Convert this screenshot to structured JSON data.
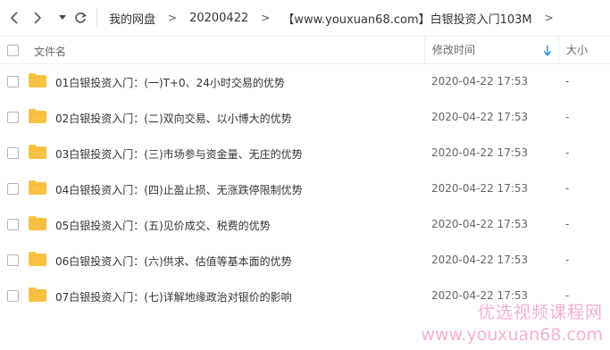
{
  "toolbar": {
    "back_icon": "chevron-left-icon",
    "forward_icon": "chevron-right-icon",
    "dropdown_icon": "caret-down-icon",
    "refresh_icon": "refresh-icon"
  },
  "breadcrumb": {
    "items": [
      "我的网盘",
      "20200422",
      "【www.youxuan68.com】白银投资入门103M"
    ],
    "separator": ">"
  },
  "table": {
    "headers": {
      "name": "文件名",
      "modified": "修改时间",
      "size": "大小"
    },
    "sort_icon": "arrow-down-icon",
    "rows": [
      {
        "name": "01白银投资入门：(一)T+0、24小时交易的优势",
        "modified": "2020-04-22 17:53",
        "size": "-"
      },
      {
        "name": "02白银投资入门：(二)双向交易、以小博大的优势",
        "modified": "2020-04-22 17:53",
        "size": "-"
      },
      {
        "name": "03白银投资入门：(三)市场参与资金量、无庄的优势",
        "modified": "2020-04-22 17:53",
        "size": "-"
      },
      {
        "name": "04白银投资入门：(四)止盈止损、无涨跌停限制优势",
        "modified": "2020-04-22 17:53",
        "size": "-"
      },
      {
        "name": "05白银投资入门：(五)见价成交、税费的优势",
        "modified": "2020-04-22 17:53",
        "size": "-"
      },
      {
        "name": "06白银投资入门：(六)供求、估值等基本面的优势",
        "modified": "2020-04-22 17:53",
        "size": "-"
      },
      {
        "name": "07白银投资入门：(七)详解地缘政治对银价的影响",
        "modified": "2020-04-22 17:53",
        "size": "-"
      }
    ]
  },
  "watermark": {
    "line1": "优选视频课程网",
    "line2": "www.youxuan68.com"
  },
  "colors": {
    "folder": "#f7c244",
    "accent": "#2f8fe6",
    "watermark": "#f0a3c9"
  }
}
